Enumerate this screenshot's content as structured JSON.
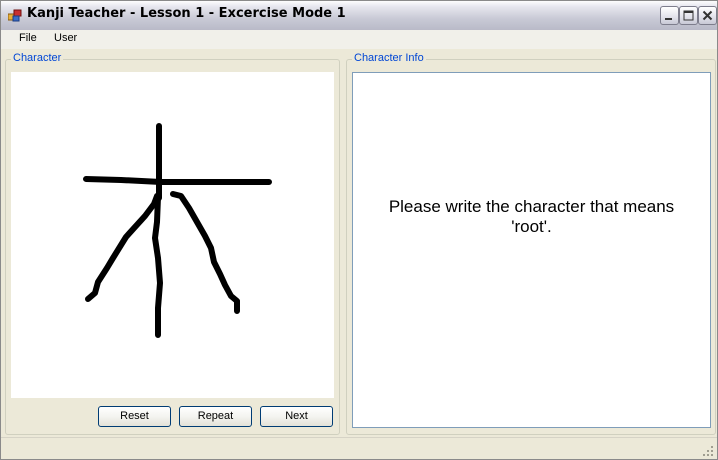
{
  "window": {
    "title": "Kanji Teacher - Lesson 1 - Excercise Mode 1",
    "icon": "app-icon"
  },
  "menu": {
    "items": [
      {
        "label": "File"
      },
      {
        "label": "User"
      }
    ]
  },
  "character_panel": {
    "title": "Character",
    "buttons": {
      "reset": "Reset",
      "repeat": "Repeat",
      "next": "Next"
    }
  },
  "info_panel": {
    "title": "Character Info",
    "prompt": "Please write the character that means 'root'."
  },
  "colors": {
    "group_title": "#0046d5",
    "window_bg": "#ece9d8",
    "ink": "#000000"
  }
}
